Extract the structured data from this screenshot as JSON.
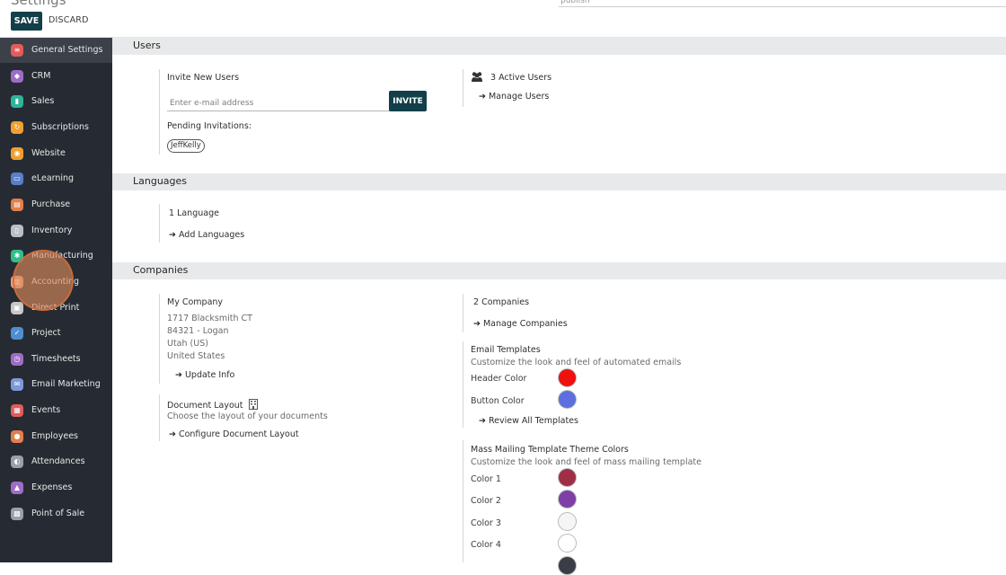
{
  "header": {
    "title": "Settings",
    "search_value": "publish"
  },
  "toolbar": {
    "save_label": "SAVE",
    "discard_label": "DISCARD"
  },
  "sidebar": {
    "items": [
      {
        "label": "General Settings",
        "color": "#e35b5b",
        "glyph": "≡"
      },
      {
        "label": "CRM",
        "color": "#9c6dc7",
        "glyph": "◆"
      },
      {
        "label": "Sales",
        "color": "#2fb49b",
        "glyph": "▮"
      },
      {
        "label": "Subscriptions",
        "color": "#f0a030",
        "glyph": "↻"
      },
      {
        "label": "Website",
        "color": "#f0a030",
        "glyph": "◉"
      },
      {
        "label": "eLearning",
        "color": "#5a7fc8",
        "glyph": "▭"
      },
      {
        "label": "Purchase",
        "color": "#e27f4a",
        "glyph": "▤"
      },
      {
        "label": "Inventory",
        "color": "#b9bec8",
        "glyph": "▯"
      },
      {
        "label": "Manufacturing",
        "color": "#2fbf8a",
        "glyph": "✱"
      },
      {
        "label": "Accounting",
        "color": "#e89a78",
        "glyph": "▥"
      },
      {
        "label": "Direct Print",
        "color": "#c7c7c7",
        "glyph": "▣"
      },
      {
        "label": "Project",
        "color": "#4f8fd0",
        "glyph": "✓"
      },
      {
        "label": "Timesheets",
        "color": "#a06cc6",
        "glyph": "◷"
      },
      {
        "label": "Email Marketing",
        "color": "#7c99d9",
        "glyph": "✉"
      },
      {
        "label": "Events",
        "color": "#e35b5b",
        "glyph": "▦"
      },
      {
        "label": "Employees",
        "color": "#e27f4a",
        "glyph": "●"
      },
      {
        "label": "Attendances",
        "color": "#9aa0a8",
        "glyph": "◐"
      },
      {
        "label": "Expenses",
        "color": "#a06cc6",
        "glyph": "▲"
      },
      {
        "label": "Point of Sale",
        "color": "#9aa0a8",
        "glyph": "▩"
      }
    ]
  },
  "users": {
    "section_title": "Users",
    "invite_label": "Invite New Users",
    "email_placeholder": "Enter e-mail address",
    "invite_button": "INVITE",
    "pending_label": "Pending Invitations:",
    "pending_user": "JeffKelly",
    "active_users": "3 Active Users",
    "manage_users": "Manage Users"
  },
  "languages": {
    "section_title": "Languages",
    "count": "1 Language",
    "add": "Add Languages"
  },
  "companies": {
    "section_title": "Companies",
    "company_name": "My Company",
    "address": [
      "1717 Blacksmith CT",
      "84321 - Logan",
      "Utah (US)",
      "United States"
    ],
    "update_info": "Update Info",
    "doc_layout_title": "Document Layout",
    "doc_layout_desc": "Choose the layout of your documents",
    "configure_layout": "Configure Document Layout",
    "companies_count": "2 Companies",
    "manage_companies": "Manage Companies",
    "email_templates_title": "Email Templates",
    "email_templates_desc": "Customize the look and feel of automated emails",
    "header_color_label": "Header Color",
    "header_color": "#f01010",
    "button_color_label": "Button Color",
    "button_color": "#5d6fdf",
    "review_templates": "Review All Templates",
    "mass_title": "Mass Mailing Template Theme Colors",
    "mass_desc": "Customize the look and feel of mass mailing template",
    "color1_label": "Color 1",
    "color1": "#9e2f47",
    "color2_label": "Color 2",
    "color2": "#7e3fa6",
    "color3_label": "Color 3",
    "color3": "#f5f5f5",
    "color4_label": "Color 4",
    "color4": "#ffffff",
    "color5": "#3a3d45"
  }
}
